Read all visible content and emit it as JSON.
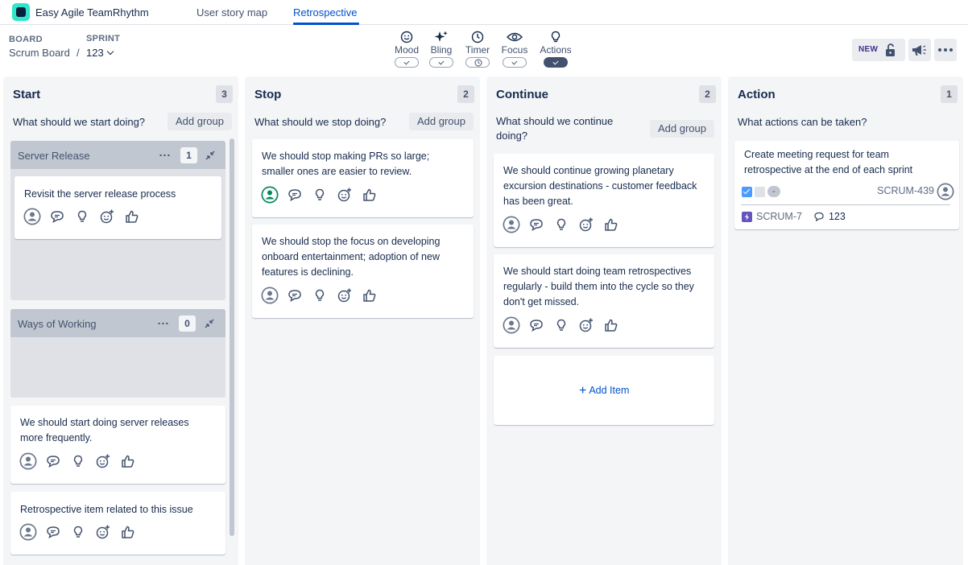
{
  "app": {
    "title": "Easy Agile TeamRhythm",
    "tabs": [
      {
        "label": "User story map",
        "active": false
      },
      {
        "label": "Retrospective",
        "active": true
      }
    ]
  },
  "header": {
    "board_label": "BOARD",
    "board_value": "Scrum Board",
    "separator": "/",
    "sprint_label": "SPRINT",
    "sprint_value": "123",
    "tools": [
      {
        "label": "Mood",
        "icon": "smiley-icon",
        "enabled": false
      },
      {
        "label": "Bling",
        "icon": "sparkles-icon",
        "enabled": false
      },
      {
        "label": "Timer",
        "icon": "clock-icon",
        "enabled": false
      },
      {
        "label": "Focus",
        "icon": "eye-icon",
        "enabled": false
      },
      {
        "label": "Actions",
        "icon": "lightbulb-icon",
        "enabled": true
      }
    ],
    "new_badge": "NEW"
  },
  "columns": [
    {
      "title": "Start",
      "count": "3",
      "prompt": "What should we start doing?",
      "add_group": "Add group",
      "groups": [
        {
          "title": "Server Release",
          "count": "1",
          "items": [
            "Revisit the server release process"
          ]
        },
        {
          "title": "Ways of Working",
          "count": "0",
          "items": []
        }
      ],
      "items": [
        "We should start doing server releases more frequently.",
        "Retrospective item related to this issue"
      ]
    },
    {
      "title": "Stop",
      "count": "2",
      "prompt": "What should we stop doing?",
      "add_group": "Add group",
      "items": [
        "We should stop making PRs so large; smaller ones are easier to review.",
        "We should stop the focus on developing onboard entertainment; adoption of new features is declining."
      ]
    },
    {
      "title": "Continue",
      "count": "2",
      "prompt": "What should we continue doing?",
      "add_group": "Add group",
      "items": [
        "We should continue growing planetary excursion destinations - customer feedback has been great.",
        "We should start doing team retrospectives regularly - build them into the cycle so they don't get missed."
      ],
      "add_item": "Add Item"
    },
    {
      "title": "Action",
      "count": "1",
      "prompt": "What actions can be taken?",
      "action_card": {
        "text": "Create meeting request for team retrospective at the end of each sprint",
        "status_chip": "-",
        "issue_key": "SCRUM-439",
        "parent_key": "SCRUM-7",
        "comment_count": "123"
      }
    }
  ],
  "colors": {
    "accent": "#0052cc",
    "column_bg": "#f4f5f7",
    "group_head": "#c1c7d0",
    "avatar_active": "#00875a",
    "epic_purple": "#6554c0",
    "checkbox_blue": "#4c9aff"
  }
}
